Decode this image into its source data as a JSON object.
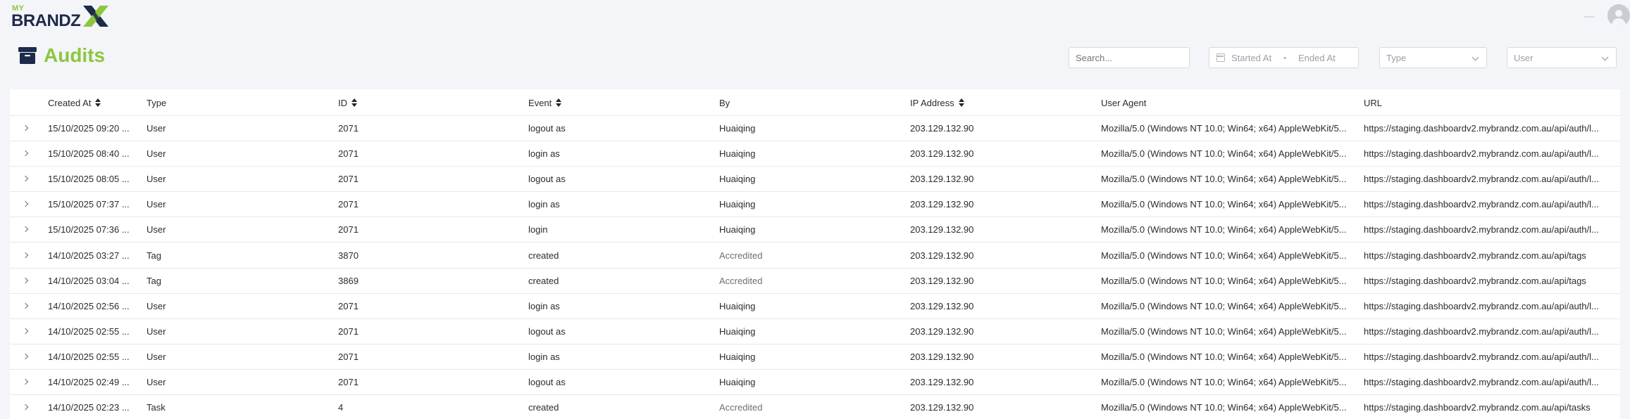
{
  "logo": {
    "top": "MY",
    "brand": "BRANDZ"
  },
  "header": {
    "title": "Audits"
  },
  "filters": {
    "search_placeholder": "Search...",
    "started_at": "Started At",
    "range_sep": "-",
    "ended_at": "Ended At",
    "type": "Type",
    "user": "User"
  },
  "colors": {
    "accent": "#8cc63f",
    "brand_dark": "#1e2a4a"
  },
  "table": {
    "columns": [
      {
        "label": "Created At",
        "sortable": true
      },
      {
        "label": "Type",
        "sortable": false
      },
      {
        "label": "ID",
        "sortable": true
      },
      {
        "label": "Event",
        "sortable": true
      },
      {
        "label": "By",
        "sortable": false
      },
      {
        "label": "IP Address",
        "sortable": true
      },
      {
        "label": "User Agent",
        "sortable": false
      },
      {
        "label": "URL",
        "sortable": false
      }
    ],
    "rows": [
      {
        "created": "15/10/2025 09:20 ...",
        "type": "User",
        "id": "2071",
        "event": "logout as",
        "by": "Huaiqing",
        "ip": "203.129.132.90",
        "agent": "Mozilla/5.0 (Windows NT 10.0; Win64; x64) AppleWebKit/5...",
        "url": "https://staging.dashboardv2.mybrandz.com.au/api/auth/l..."
      },
      {
        "created": "15/10/2025 08:40 ...",
        "type": "User",
        "id": "2071",
        "event": "login as",
        "by": "Huaiqing",
        "ip": "203.129.132.90",
        "agent": "Mozilla/5.0 (Windows NT 10.0; Win64; x64) AppleWebKit/5...",
        "url": "https://staging.dashboardv2.mybrandz.com.au/api/auth/l..."
      },
      {
        "created": "15/10/2025 08:05 ...",
        "type": "User",
        "id": "2071",
        "event": "logout as",
        "by": "Huaiqing",
        "ip": "203.129.132.90",
        "agent": "Mozilla/5.0 (Windows NT 10.0; Win64; x64) AppleWebKit/5...",
        "url": "https://staging.dashboardv2.mybrandz.com.au/api/auth/l..."
      },
      {
        "created": "15/10/2025 07:37 ...",
        "type": "User",
        "id": "2071",
        "event": "login as",
        "by": "Huaiqing",
        "ip": "203.129.132.90",
        "agent": "Mozilla/5.0 (Windows NT 10.0; Win64; x64) AppleWebKit/5...",
        "url": "https://staging.dashboardv2.mybrandz.com.au/api/auth/l..."
      },
      {
        "created": "15/10/2025 07:36 ...",
        "type": "User",
        "id": "2071",
        "event": "login",
        "by": "Huaiqing",
        "ip": "203.129.132.90",
        "agent": "Mozilla/5.0 (Windows NT 10.0; Win64; x64) AppleWebKit/5...",
        "url": "https://staging.dashboardv2.mybrandz.com.au/api/auth/l..."
      },
      {
        "created": "14/10/2025 03:27 ...",
        "type": "Tag",
        "id": "3870",
        "event": "created",
        "by": "Accredited",
        "ip": "203.129.132.90",
        "agent": "Mozilla/5.0 (Windows NT 10.0; Win64; x64) AppleWebKit/5...",
        "url": "https://staging.dashboardv2.mybrandz.com.au/api/tags"
      },
      {
        "created": "14/10/2025 03:04 ...",
        "type": "Tag",
        "id": "3869",
        "event": "created",
        "by": "Accredited",
        "ip": "203.129.132.90",
        "agent": "Mozilla/5.0 (Windows NT 10.0; Win64; x64) AppleWebKit/5...",
        "url": "https://staging.dashboardv2.mybrandz.com.au/api/tags"
      },
      {
        "created": "14/10/2025 02:56 ...",
        "type": "User",
        "id": "2071",
        "event": "login as",
        "by": "Huaiqing",
        "ip": "203.129.132.90",
        "agent": "Mozilla/5.0 (Windows NT 10.0; Win64; x64) AppleWebKit/5...",
        "url": "https://staging.dashboardv2.mybrandz.com.au/api/auth/l..."
      },
      {
        "created": "14/10/2025 02:55 ...",
        "type": "User",
        "id": "2071",
        "event": "logout as",
        "by": "Huaiqing",
        "ip": "203.129.132.90",
        "agent": "Mozilla/5.0 (Windows NT 10.0; Win64; x64) AppleWebKit/5...",
        "url": "https://staging.dashboardv2.mybrandz.com.au/api/auth/l..."
      },
      {
        "created": "14/10/2025 02:55 ...",
        "type": "User",
        "id": "2071",
        "event": "login as",
        "by": "Huaiqing",
        "ip": "203.129.132.90",
        "agent": "Mozilla/5.0 (Windows NT 10.0; Win64; x64) AppleWebKit/5...",
        "url": "https://staging.dashboardv2.mybrandz.com.au/api/auth/l..."
      },
      {
        "created": "14/10/2025 02:49 ...",
        "type": "User",
        "id": "2071",
        "event": "logout as",
        "by": "Huaiqing",
        "ip": "203.129.132.90",
        "agent": "Mozilla/5.0 (Windows NT 10.0; Win64; x64) AppleWebKit/5...",
        "url": "https://staging.dashboardv2.mybrandz.com.au/api/auth/l..."
      },
      {
        "created": "14/10/2025 02:23 ...",
        "type": "Task",
        "id": "4",
        "event": "created",
        "by": "Accredited",
        "ip": "203.129.132.90",
        "agent": "Mozilla/5.0 (Windows NT 10.0; Win64; x64) AppleWebKit/5...",
        "url": "https://staging.dashboardv2.mybrandz.com.au/api/tasks"
      }
    ]
  }
}
